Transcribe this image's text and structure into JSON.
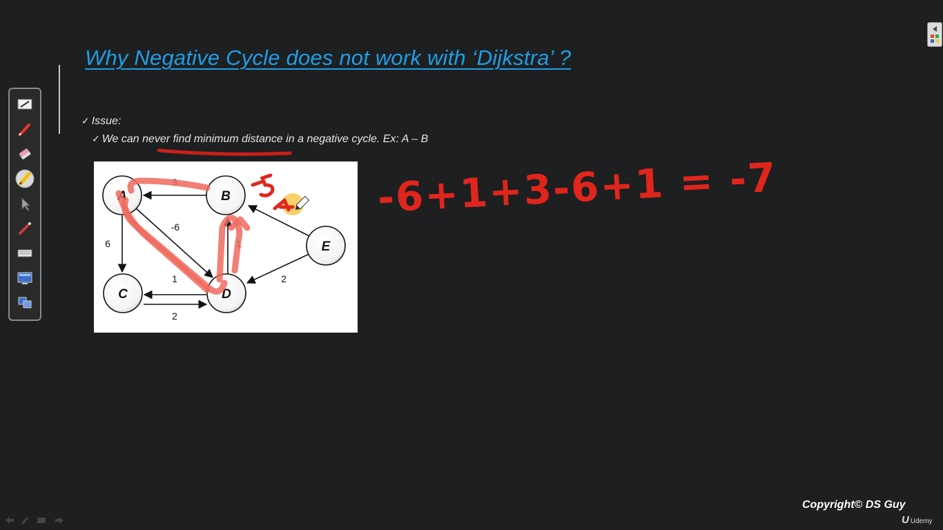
{
  "slide": {
    "title": "Why Negative Cycle does not work with ‘Dijkstra’ ?",
    "issue_label": "Issue:",
    "issue_text": "We can never find minimum distance in a negative cycle. Ex: A – B",
    "check_mark": "✓"
  },
  "graph": {
    "nodes": [
      "A",
      "B",
      "C",
      "D",
      "E"
    ],
    "edges": [
      {
        "from": "B",
        "to": "A",
        "weight": "3"
      },
      {
        "from": "A",
        "to": "D",
        "weight": "-6"
      },
      {
        "from": "A",
        "to": "C",
        "weight": "6"
      },
      {
        "from": "D",
        "to": "B",
        "weight": "1"
      },
      {
        "from": "D",
        "to": "C",
        "weight": "1"
      },
      {
        "from": "C",
        "to": "D",
        "weight": "2"
      },
      {
        "from": "E",
        "to": "B",
        "weight": ""
      },
      {
        "from": "E",
        "to": "D",
        "weight": "2"
      }
    ]
  },
  "annotations": {
    "equation": "-6+1+3-6+1 = -7",
    "scribble_b": "-5",
    "scribble_e": "-4",
    "ink_color": "#e0261c"
  },
  "toolbar": {
    "tools": [
      "whiteboard-icon",
      "pen-icon",
      "eraser-icon",
      "highlighter-icon",
      "pointer-icon",
      "laser-pen-icon",
      "keyboard-icon",
      "screen-icon",
      "display-icon"
    ]
  },
  "footer": {
    "copyright": "Copyright© DS Guy",
    "udemy_mark": "U",
    "udemy_label": "Udemy"
  }
}
